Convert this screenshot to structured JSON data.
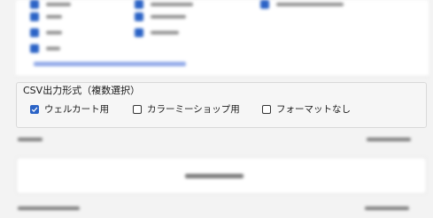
{
  "csv_format": {
    "legend": "CSV出力形式（複数選択）",
    "options": [
      {
        "label": "ウェルカート用",
        "checked": true
      },
      {
        "label": "カラーミーショップ用",
        "checked": false
      },
      {
        "label": "フォーマットなし",
        "checked": false
      }
    ]
  },
  "colors": {
    "accent": "#2b63c6",
    "background": "#f3f3f3",
    "panel": "#ffffff",
    "border": "#d9d9d9"
  },
  "icons": {
    "checked": "checkmark-icon"
  }
}
